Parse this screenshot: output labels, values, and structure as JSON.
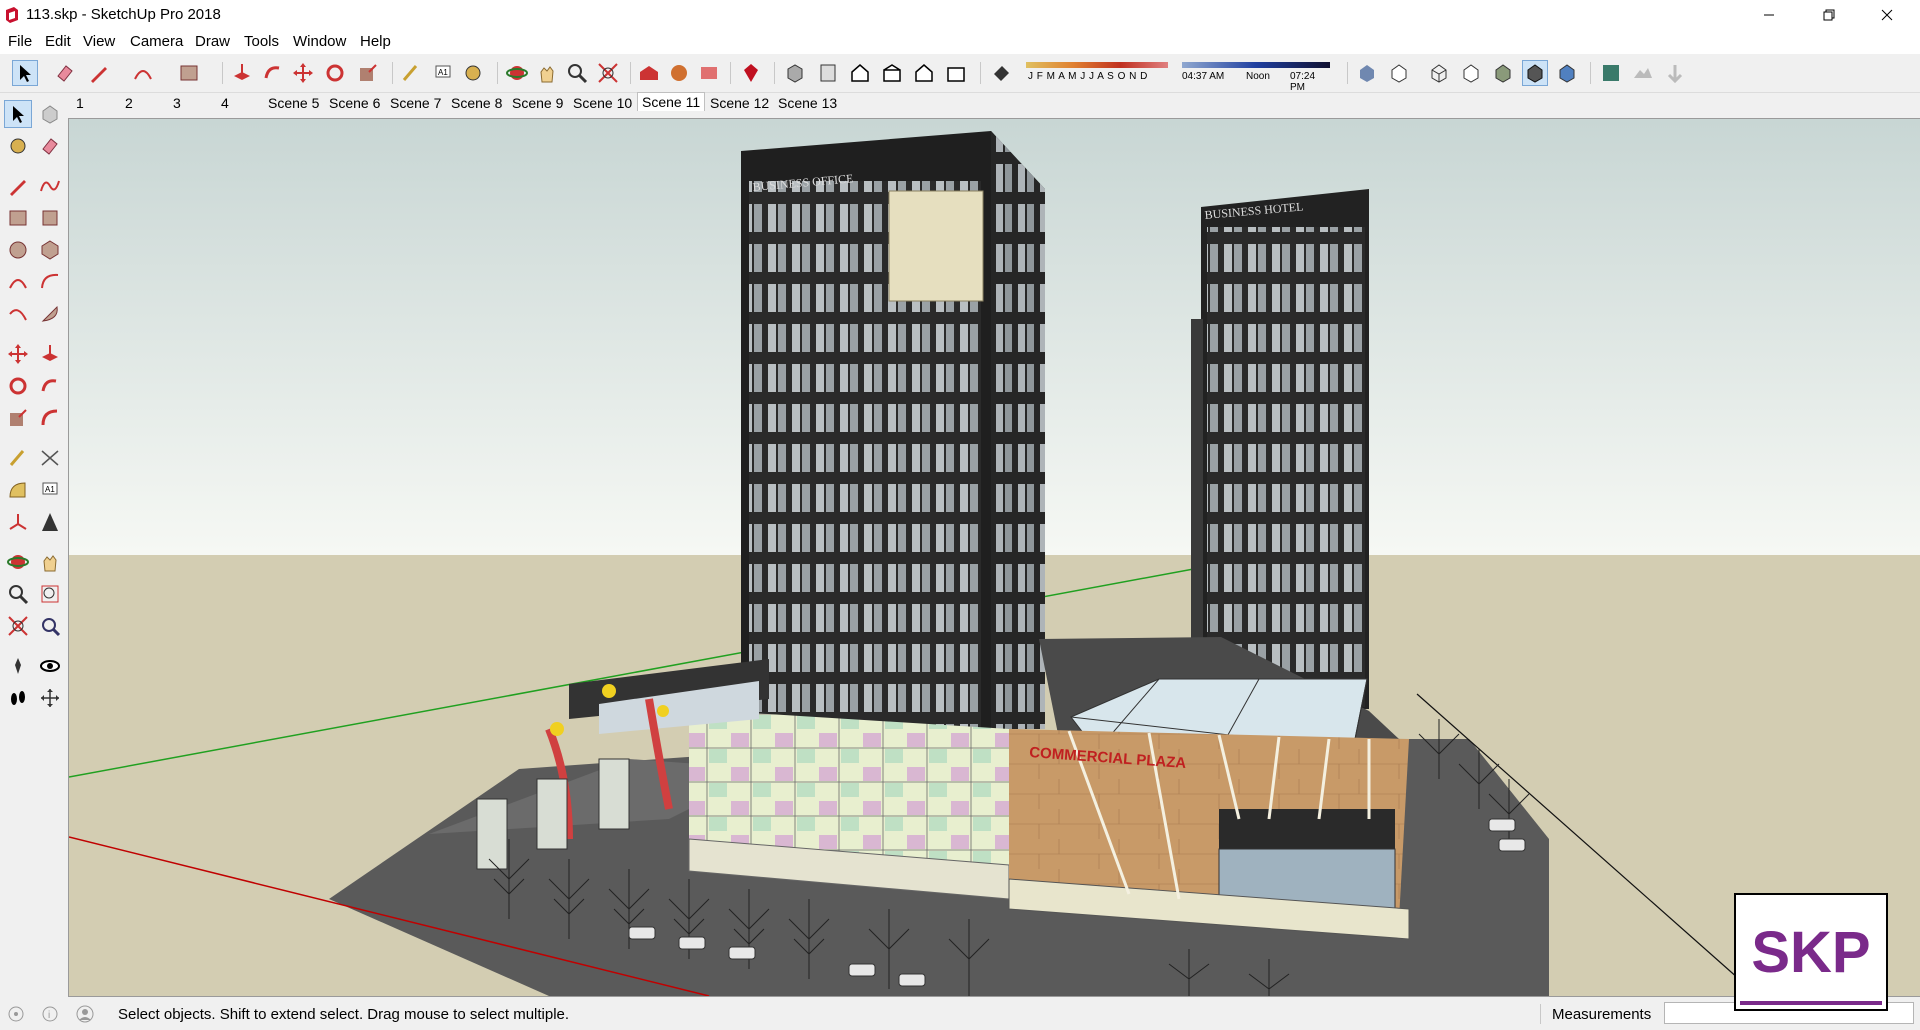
{
  "window": {
    "title": "113.skp - SketchUp Pro 2018"
  },
  "menu": [
    "File",
    "Edit",
    "View",
    "Camera",
    "Draw",
    "Tools",
    "Window",
    "Help"
  ],
  "shadow": {
    "months": "J F M A M J J A S O N D",
    "times": [
      "04:37 AM",
      "Noon",
      "07:24 PM"
    ]
  },
  "scenes": {
    "tabs": [
      "1",
      "2",
      "3",
      "4",
      "Scene 5",
      "Scene 6",
      "Scene 7",
      "Scene 8",
      "Scene 9",
      "Scene 10",
      "Scene 11",
      "Scene 12",
      "Scene 13"
    ],
    "active": "Scene 11"
  },
  "model": {
    "tower_left_label": "BUSINESS OFFICE",
    "tower_right_label": "BUSINESS HOTEL",
    "podium_label": "COMMERCIAL PLAZA"
  },
  "status": {
    "message": "Select objects. Shift to extend select. Drag mouse to select multiple.",
    "measurements_label": "Measurements",
    "measurements_value": ""
  },
  "watermark": {
    "text": "SKP"
  },
  "colors": {
    "accent_purple": "#7a2a8a",
    "x_axis": "#c00000",
    "y_axis": "#20a020"
  }
}
